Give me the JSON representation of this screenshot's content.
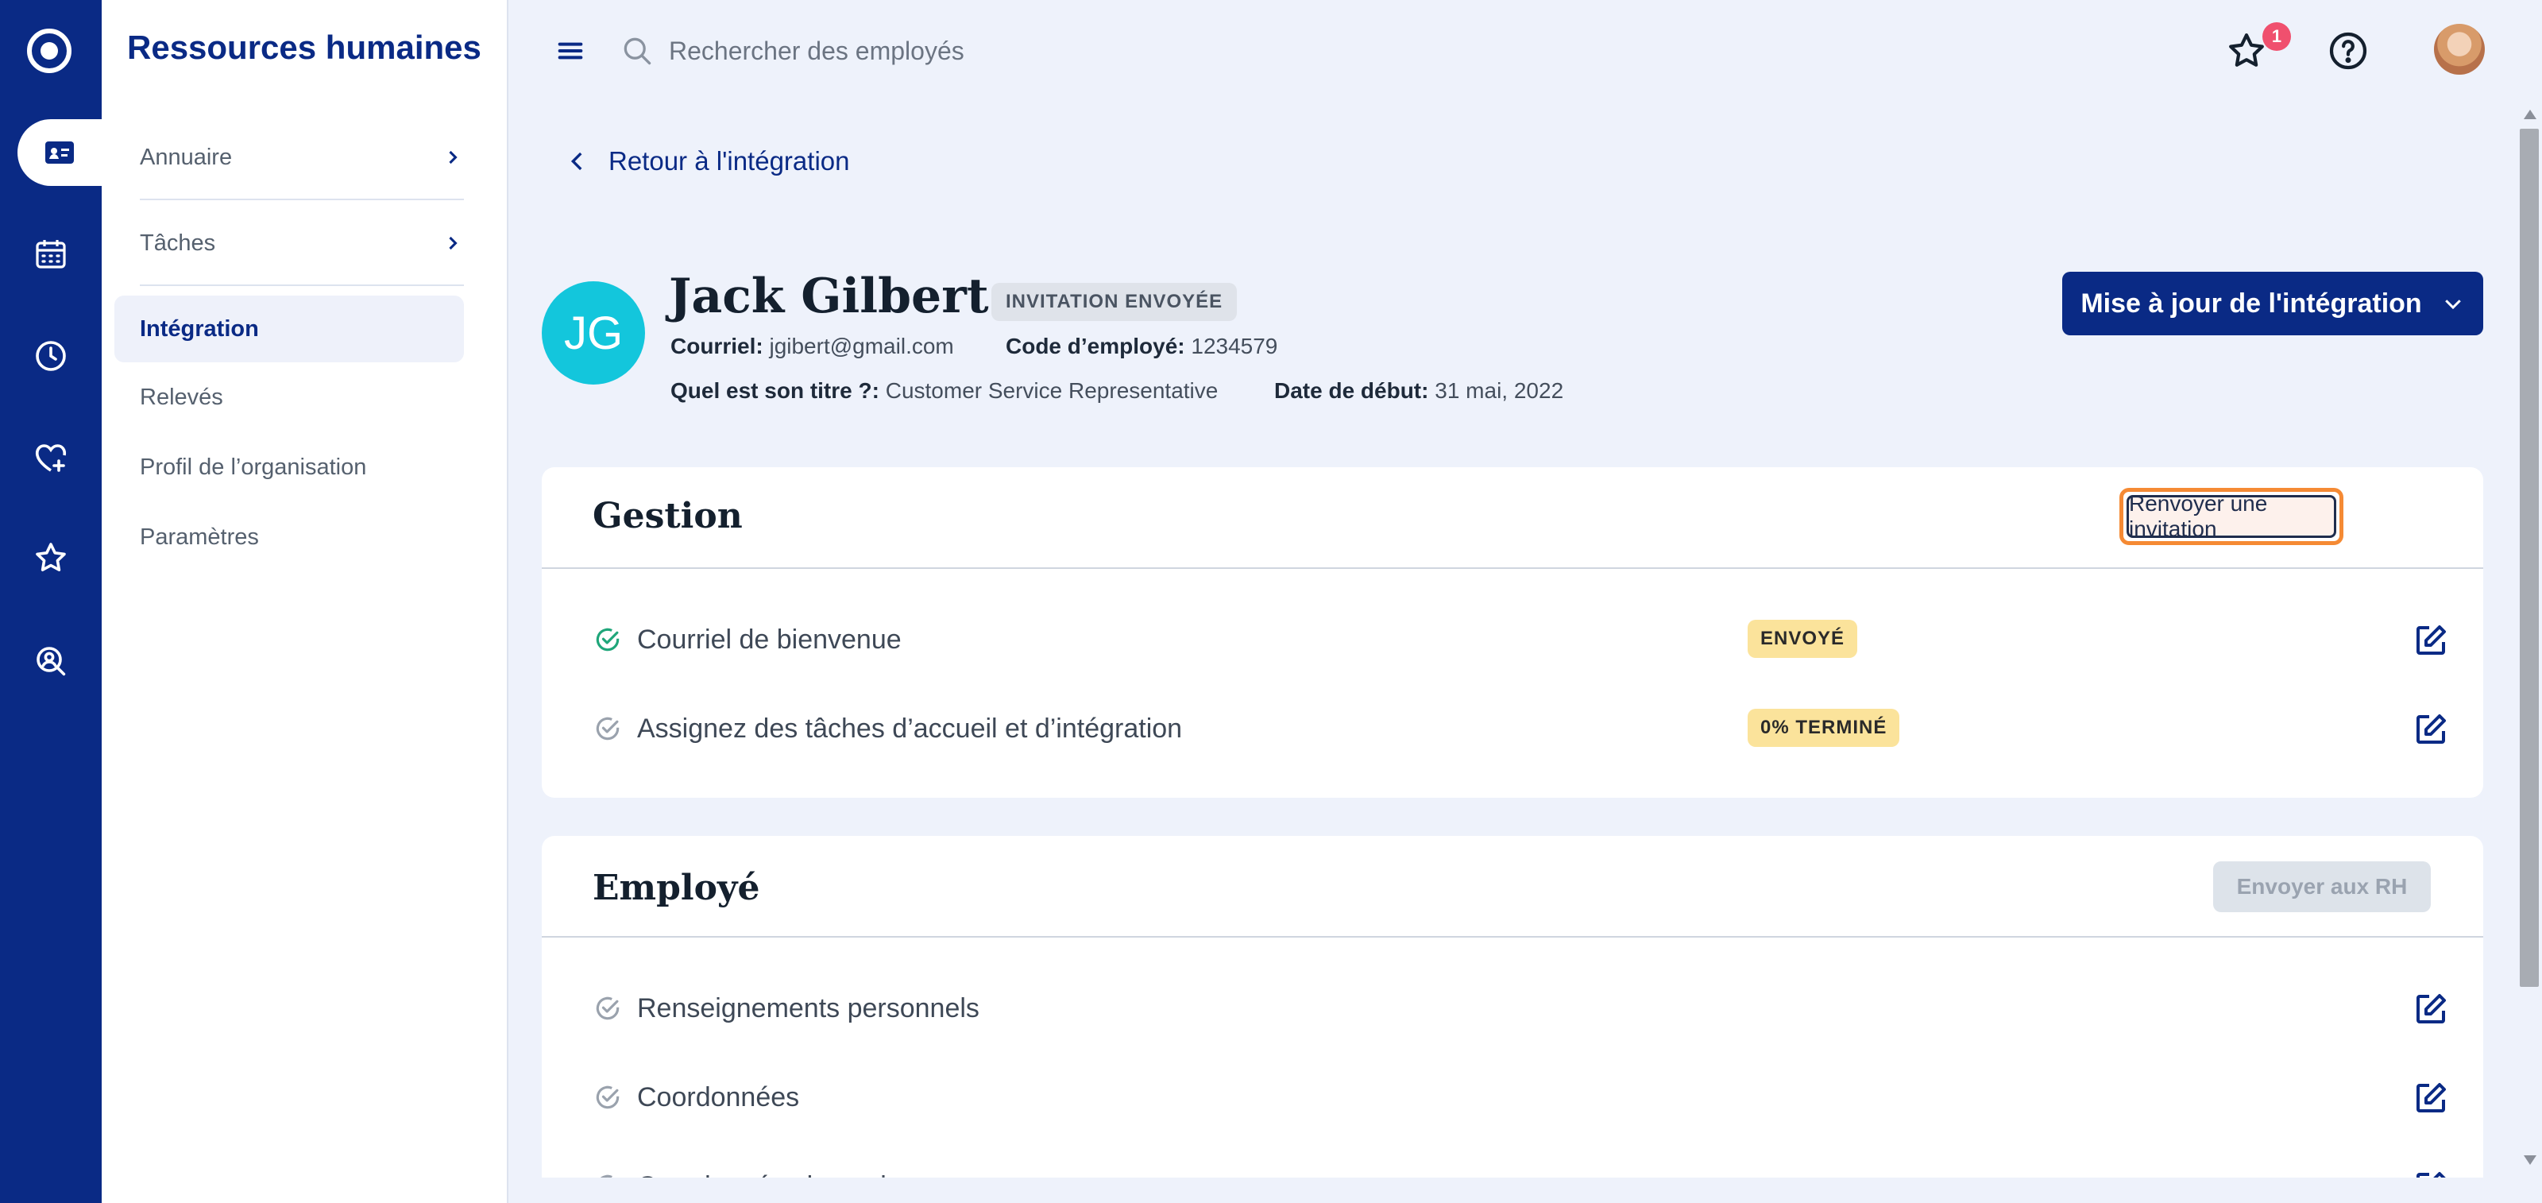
{
  "app": {
    "title": "Ressources humaines"
  },
  "rail": {
    "icons": [
      "logo-icon",
      "employee-card-icon",
      "calendar-icon",
      "clock-icon",
      "heart-plus-icon",
      "star-icon",
      "search-person-icon"
    ]
  },
  "sidebar": {
    "items": [
      {
        "label": "Annuaire",
        "has_chevron": true
      },
      {
        "label": "Tâches",
        "has_chevron": true
      },
      {
        "label": "Intégration",
        "active": true
      },
      {
        "label": "Relevés"
      },
      {
        "label": "Profil de l’organisation"
      },
      {
        "label": "Paramètres"
      }
    ]
  },
  "topbar": {
    "search_placeholder": "Rechercher des employés",
    "notification_count": "1"
  },
  "page": {
    "back_label": "Retour à l'intégration",
    "employee": {
      "initials": "JG",
      "name": "Jack Gilbert",
      "status": "INVITATION ENVOYÉE",
      "email_label": "Courriel:",
      "email": "jgibert@gmail.com",
      "code_label": "Code d’employé:",
      "code": "1234579",
      "title_label": "Quel est son titre ?:",
      "title": "Customer Service Representative",
      "start_label": "Date de début:",
      "start": "31 mai, 2022"
    },
    "update_button": "Mise à jour de l'intégration",
    "gestion": {
      "title": "Gestion",
      "button": "Renvoyer une invitation",
      "rows": [
        {
          "label": "Courriel de bienvenue",
          "chip": "ENVOYÉ",
          "done": true
        },
        {
          "label": "Assignez des tâches d’accueil et d’intégration",
          "chip": "0% TERMINÉ",
          "done": false
        }
      ]
    },
    "employe": {
      "title": "Employé",
      "button": "Envoyer aux RH",
      "rows": [
        {
          "label": "Renseignements personnels"
        },
        {
          "label": "Coordonnées"
        },
        {
          "label": "Coordonnées bancaires"
        }
      ]
    }
  },
  "colors": {
    "brand": "#0a2a85",
    "avatar": "#13c6dc",
    "chip_yellow": "#fbe39b",
    "focus_ring": "#f58a34",
    "done_check": "#1fa67a"
  }
}
